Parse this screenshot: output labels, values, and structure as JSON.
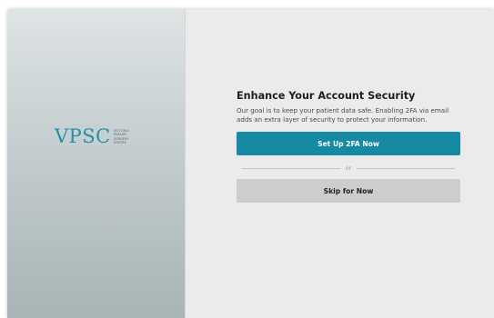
{
  "brand": {
    "logo_text": "VPSC",
    "logo_sub_lines": [
      "VICTORIA",
      "PARADE",
      "SURGERY",
      "CENTRE"
    ],
    "accent_color": "#168aa3"
  },
  "security_prompt": {
    "title": "Enhance Your Account Security",
    "description": "Our goal is to keep your patient data safe. Enabling 2FA via email adds an extra layer of security to protect your information.",
    "setup_button_label": "Set Up 2FA Now",
    "divider_label": "or",
    "skip_button_label": "Skip for Now"
  }
}
